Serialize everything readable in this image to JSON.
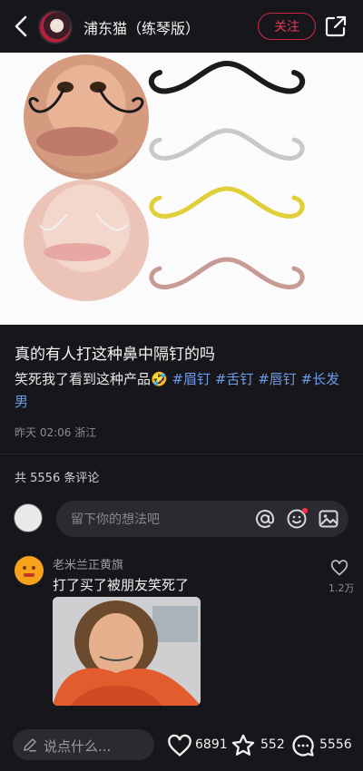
{
  "header": {
    "author_name": "浦东猫（练琴版）",
    "follow_label": "关注",
    "icons": {
      "back": "chevron-left-icon",
      "share": "share-icon"
    }
  },
  "post": {
    "title": "真的有人打这种鼻中隔钉的吗",
    "body_text": "笑死我了看到这种产品🤣",
    "tags": [
      "#眉钉",
      "#舌钉",
      "#唇钉",
      "#长发男"
    ],
    "meta": "昨天 02:06 浙江"
  },
  "comments_section": {
    "count_label": "共 5556 条评论",
    "input_placeholder": "留下你的想法吧",
    "comment": {
      "author": "老米兰正黄旗",
      "text": "打了买了被朋友笑死了",
      "likes": "1.2万"
    }
  },
  "bottom_bar": {
    "say_label": "说点什么...",
    "likes_count": "6891",
    "favorites_count": "552",
    "comments_count": "5556"
  },
  "colors": {
    "accent": "#e23a5b",
    "tag": "#6d9be8",
    "background": "#17171b"
  }
}
